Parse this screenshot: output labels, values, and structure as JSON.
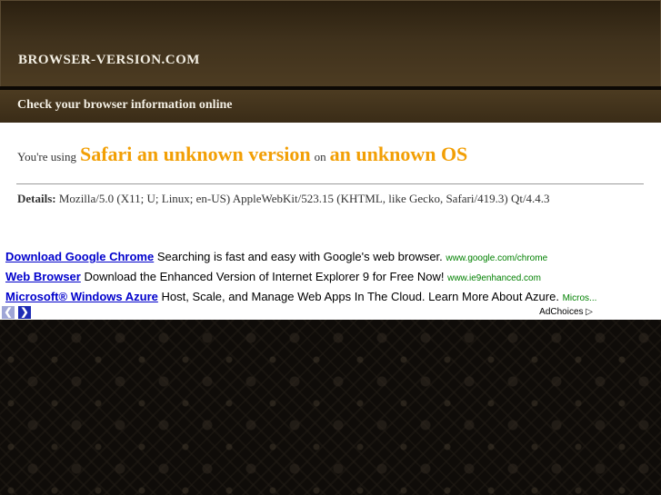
{
  "header": {
    "site_name": "BROWSER-VERSION.COM",
    "tagline": "Check your browser information online"
  },
  "result": {
    "prefix": "You're using",
    "browser": "Safari an unknown version",
    "joiner": "on",
    "os": "an unknown OS"
  },
  "details": {
    "label": "Details:",
    "user_agent": "Mozilla/5.0 (X11; U; Linux; en-US) AppleWebKit/523.15 (KHTML, like Gecko, Safari/419.3) Qt/4.4.3"
  },
  "ads": [
    {
      "title": "Download Google Chrome",
      "text": "Searching is fast and easy with Google's web browser.",
      "url": "www.google.com/chrome"
    },
    {
      "title": "Web Browser",
      "text": "Download the Enhanced Version of Internet Explorer 9 for Free Now!",
      "url": "www.ie9enhanced.com"
    },
    {
      "title": "Microsoft® Windows Azure",
      "text": "Host, Scale, and Manage Web Apps In The Cloud. Learn More About Azure.",
      "url": "Micros..."
    }
  ],
  "ad_nav": {
    "prev_icon": "chevron-left-icon",
    "next_icon": "chevron-right-icon",
    "adchoices_label": "AdChoices",
    "adchoices_icon": "play-triangle-icon"
  },
  "colors": {
    "accent_orange": "#f29f05",
    "header_brown": "#3f311c",
    "ad_link_blue": "#0000cc",
    "ad_url_green": "#008000"
  }
}
